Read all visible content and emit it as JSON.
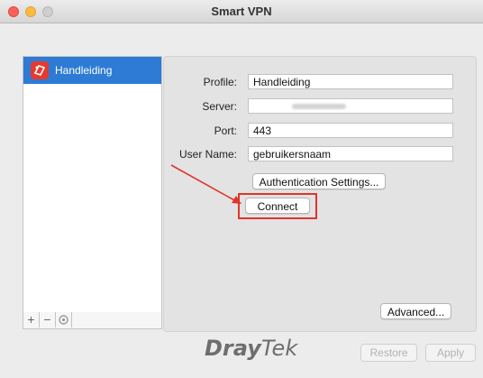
{
  "window": {
    "title": "Smart VPN"
  },
  "sidebar": {
    "items": [
      {
        "label": "Handleiding",
        "icon": "profile-logo-icon",
        "selected": true
      }
    ],
    "tools": {
      "add": "+",
      "remove": "−",
      "settings_icon": "gear-icon"
    }
  },
  "form": {
    "profile_label": "Profile:",
    "profile_value": "Handleiding",
    "server_label": "Server:",
    "server_value": "",
    "port_label": "Port:",
    "port_value": "443",
    "username_label": "User Name:",
    "username_value": "gebruikersnaam"
  },
  "buttons": {
    "auth_settings": "Authentication Settings...",
    "connect": "Connect",
    "advanced": "Advanced...",
    "restore": "Restore",
    "apply": "Apply"
  },
  "brand": {
    "bold": "Dray",
    "regular": "Tek"
  },
  "colors": {
    "selection": "#2d7bd4",
    "annotation": "#e0352b"
  }
}
